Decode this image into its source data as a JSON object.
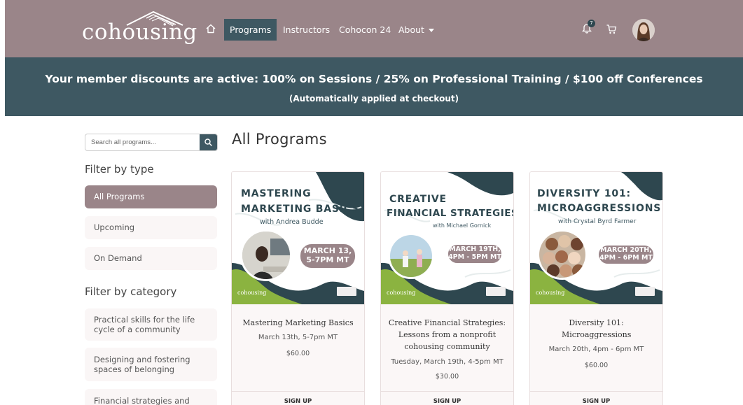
{
  "header": {
    "logo_text": "cohousing",
    "nav": [
      "Programs",
      "Instructors",
      "Cohocon 24",
      "About"
    ],
    "active_nav": "Programs",
    "notification_count": "7"
  },
  "banner": {
    "main": "Your member discounts are active: 100% on Sessions / 25% on Professional Training / $100 off Conferences",
    "sub": "(Automatically applied at checkout)"
  },
  "sidebar": {
    "search_placeholder": "Search all programs...",
    "filter_type_heading": "Filter by type",
    "types": [
      "All Programs",
      "Upcoming",
      "On Demand"
    ],
    "active_type": "All Programs",
    "filter_category_heading": "Filter by category",
    "categories": [
      "Practical skills for the life cycle of a community",
      "Designing and fostering spaces of belonging",
      "Financial strategies and"
    ]
  },
  "main": {
    "title": "All Programs",
    "cards": [
      {
        "image_title_1": "MASTERING",
        "image_title_2": "MARKETING BASICS",
        "image_with": "with Andrea Budde",
        "image_date_1": "MARCH 13,",
        "image_date_2": "5-7PM MT",
        "image_logo": "cohousing",
        "title": "Mastering Marketing Basics",
        "date": "March 13th, 5-7pm MT",
        "price": "$60.00",
        "signup": "SIGN UP"
      },
      {
        "image_title_1": "CREATIVE",
        "image_title_2": "FINANCIAL STRATEGIES",
        "image_with": "with Michael Gornick",
        "image_date_1": "MARCH 19TH,",
        "image_date_2": "4PM - 5PM MT",
        "image_logo": "cohousing",
        "title": "Creative Financial Strategies: Lessons from a nonprofit cohousing community",
        "date": "Tuesday, March 19th, 4-5pm MT",
        "price": "$30.00",
        "signup": "SIGN UP"
      },
      {
        "image_title_1": "DIVERSITY 101:",
        "image_title_2": "MICROAGGRESSIONS",
        "image_with": "with Crystal Byrd Farmer",
        "image_date_1": "MARCH 20TH,",
        "image_date_2": "4PM - 6PM MT",
        "image_logo": "cohousing",
        "title": "Diversity 101: Microaggressions",
        "date": "March 20th, 4pm - 6pm MT",
        "price": "$60.00",
        "signup": "SIGN UP"
      }
    ]
  },
  "colors": {
    "header_bg": "#9a8589",
    "banner_bg": "#3e5862",
    "accent_green": "#2e474f"
  },
  "icons": [
    "home-icon",
    "search-icon",
    "bell-icon",
    "cart-icon",
    "caret-down-icon"
  ]
}
